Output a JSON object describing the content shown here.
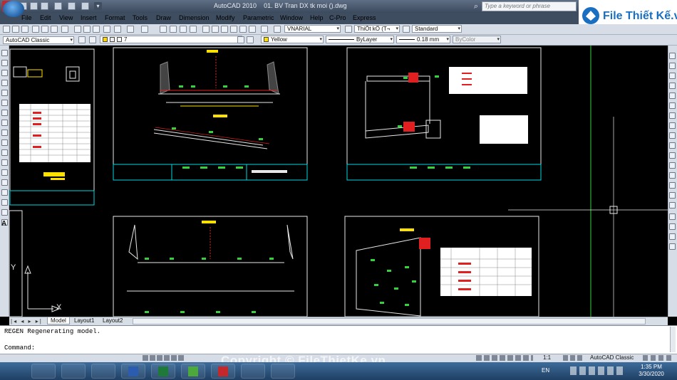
{
  "window": {
    "app_title": "AutoCAD 2010",
    "file_title": "01. BV Tran DX tk moi ().dwg",
    "search_placeholder": "Type a keyword or phrase",
    "brand": "File Thiết Kế.vn"
  },
  "menu": [
    "File",
    "Edit",
    "View",
    "Insert",
    "Format",
    "Tools",
    "Draw",
    "Dimension",
    "Modify",
    "Parametric",
    "Window",
    "Help",
    "C-Pro",
    "Express"
  ],
  "toolbar": {
    "workspace": "AutoCAD Classic",
    "layer": "7",
    "text_style": "VNARIAL",
    "dim_style": "ThiÕt kÕ (T¬",
    "table_style": "Standard",
    "color": "Yellow",
    "linetype": "ByLayer",
    "lineweight": "0.18 mm",
    "plotstyle": "ByColor"
  },
  "colors": {
    "accent_green": "#34d23c",
    "accent_red": "#e02020",
    "sheet_border": "#e8e8e8",
    "title_block": "#00d7e0",
    "yellow": "#ffe100"
  },
  "layout_tabs": [
    "Model",
    "Layout1",
    "Layout2"
  ],
  "command": {
    "history": "REGEN Regenerating model.",
    "prompt": "Command:"
  },
  "status": {
    "scale": "1:1",
    "workspace": "AutoCAD Classic"
  },
  "ucs": {
    "x_label": "X",
    "y_label": "Y"
  },
  "taskbar": {
    "lang": "EN",
    "time": "1:35 PM",
    "date": "3/30/2020"
  },
  "watermark": "Copyright © FileThietKe.vn"
}
